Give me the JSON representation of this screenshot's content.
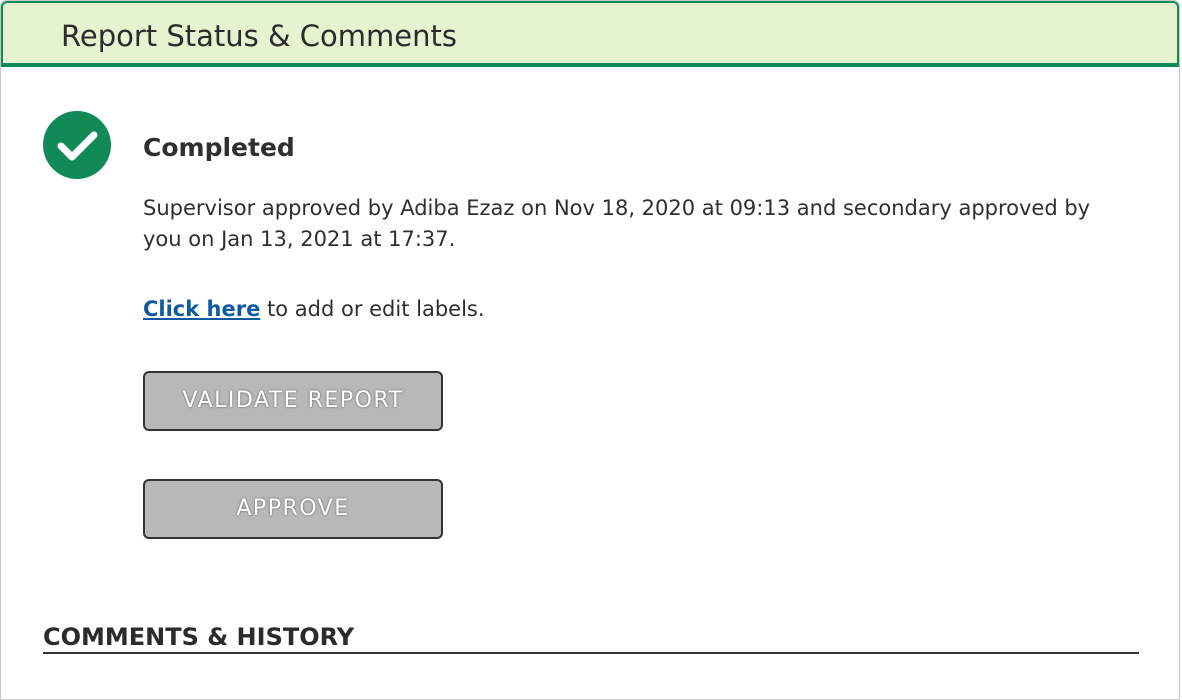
{
  "panel": {
    "title": "Report Status & Comments"
  },
  "status": {
    "icon": "check-circle-icon",
    "label": "Completed",
    "approval_text": "Supervisor approved by Adiba Ezaz on Nov 18, 2020 at 09:13 and secondary approved by you on Jan 13, 2021 at 17:37."
  },
  "labels": {
    "link_text": "Click here",
    "suffix_text": " to add or edit labels."
  },
  "actions": {
    "validate_label": "VALIDATE REPORT",
    "approve_label": "APPROVE"
  },
  "comments": {
    "section_title": "COMMENTS & HISTORY"
  },
  "colors": {
    "accent_green": "#118a57",
    "header_bg": "#e6f3d1",
    "link_blue": "#0f5a9e",
    "button_gray": "#b8b8b8"
  }
}
